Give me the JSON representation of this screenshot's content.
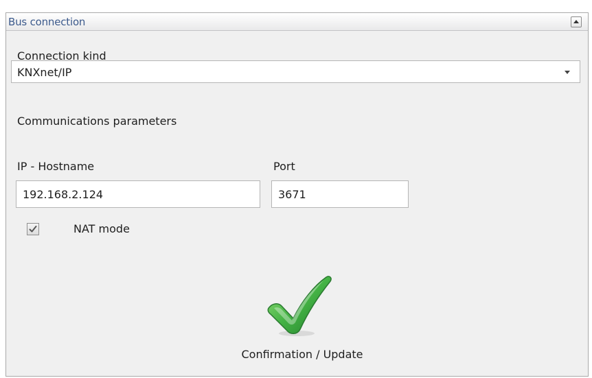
{
  "panel": {
    "title": "Bus connection",
    "collapse_icon": "chevron-up-icon"
  },
  "connection": {
    "label": "Connection kind",
    "selected": "KNXnet/IP",
    "dropdown_icon": "chevron-down-icon"
  },
  "parameters": {
    "heading": "Communications parameters",
    "ip_label": "IP - Hostname",
    "ip_value": "192.168.2.124",
    "port_label": "Port",
    "port_value": "3671",
    "nat_label": "NAT mode",
    "nat_checked": true
  },
  "confirm": {
    "label": "Confirmation / Update",
    "icon": "checkmark-icon",
    "icon_color": "#3fae3f"
  },
  "colors": {
    "title_text": "#3c5a8c",
    "panel_bg": "#f0f0f0"
  }
}
